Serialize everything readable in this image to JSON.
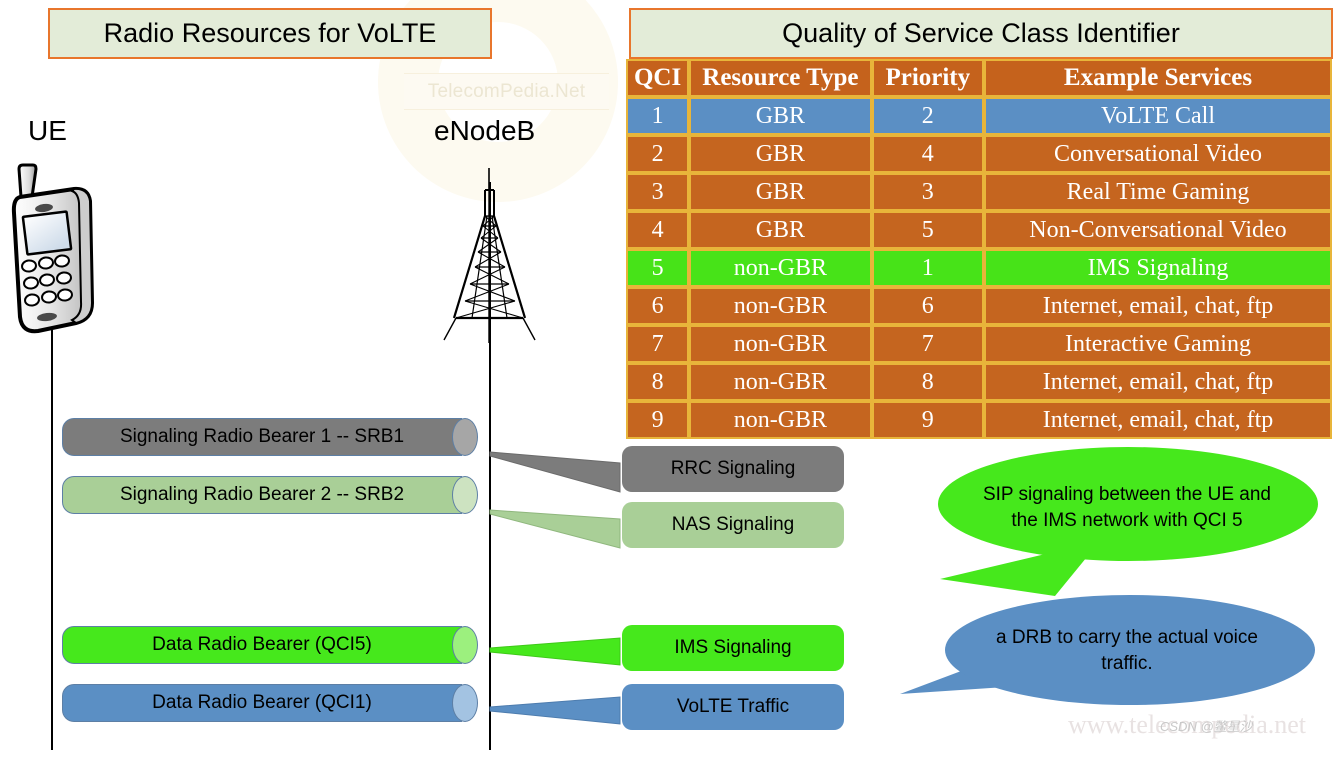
{
  "titles": {
    "left": "Radio Resources for VoLTE",
    "right": "Quality of Service Class Identifier"
  },
  "watermarks": {
    "center_banner": "TelecomPedia.Net",
    "site": "www.telecompedia.net",
    "csdn": "CSDN @鳖星沙"
  },
  "nodes": {
    "ue_label": "UE",
    "enodeb_label": "eNodeB"
  },
  "qci_table": {
    "headers": [
      "QCI",
      "Resource Type",
      "Priority",
      "Example Services"
    ],
    "rows": [
      {
        "qci": "1",
        "resource_type": "GBR",
        "priority": "2",
        "example": "VoLTE Call",
        "highlight": "blue"
      },
      {
        "qci": "2",
        "resource_type": "GBR",
        "priority": "4",
        "example": "Conversational Video",
        "highlight": "none"
      },
      {
        "qci": "3",
        "resource_type": "GBR",
        "priority": "3",
        "example": "Real Time Gaming",
        "highlight": "none"
      },
      {
        "qci": "4",
        "resource_type": "GBR",
        "priority": "5",
        "example": "Non-Conversational Video",
        "highlight": "none"
      },
      {
        "qci": "5",
        "resource_type": "non-GBR",
        "priority": "1",
        "example": "IMS Signaling",
        "highlight": "green"
      },
      {
        "qci": "6",
        "resource_type": "non-GBR",
        "priority": "6",
        "example": "Internet, email, chat, ftp",
        "highlight": "none"
      },
      {
        "qci": "7",
        "resource_type": "non-GBR",
        "priority": "7",
        "example": "Interactive Gaming",
        "highlight": "none"
      },
      {
        "qci": "8",
        "resource_type": "non-GBR",
        "priority": "8",
        "example": "Internet, email, chat, ftp",
        "highlight": "none"
      },
      {
        "qci": "9",
        "resource_type": "non-GBR",
        "priority": "9",
        "example": "Internet, email, chat, ftp",
        "highlight": "none"
      }
    ]
  },
  "bearers": [
    {
      "label": "Signaling Radio Bearer 1  --  SRB1",
      "color": "#7c7c7c"
    },
    {
      "label": "Signaling Radio Bearer 2  --  SRB2",
      "color": "#a9cf97"
    },
    {
      "label": "Data Radio Bearer (QCI5)",
      "color": "#46e81c"
    },
    {
      "label": "Data Radio Bearer (QCI1)",
      "color": "#5b8fc4"
    }
  ],
  "signaling_boxes": [
    {
      "label": "RRC Signaling",
      "color": "#7c7c7c"
    },
    {
      "label": "NAS Signaling",
      "color": "#a9cf97"
    },
    {
      "label": "IMS Signaling",
      "color": "#46e81c"
    },
    {
      "label": "VoLTE Traffic",
      "color": "#5b8fc4"
    }
  ],
  "callouts": [
    {
      "text": "SIP signaling between the UE and the IMS network with QCI 5",
      "color": "#46e81c"
    },
    {
      "text": "a DRB to carry the actual voice traffic.",
      "color": "#5b8fc4"
    }
  ],
  "colors": {
    "title_bg": "#e3ecd8",
    "title_border": "#e8762c",
    "table_header": "#c5621c",
    "table_row": "#c5651f",
    "table_divider": "#e8b53a",
    "blue": "#5b8fc4",
    "green": "#46e81c",
    "grey": "#7c7c7c",
    "light_green": "#a9cf97"
  }
}
